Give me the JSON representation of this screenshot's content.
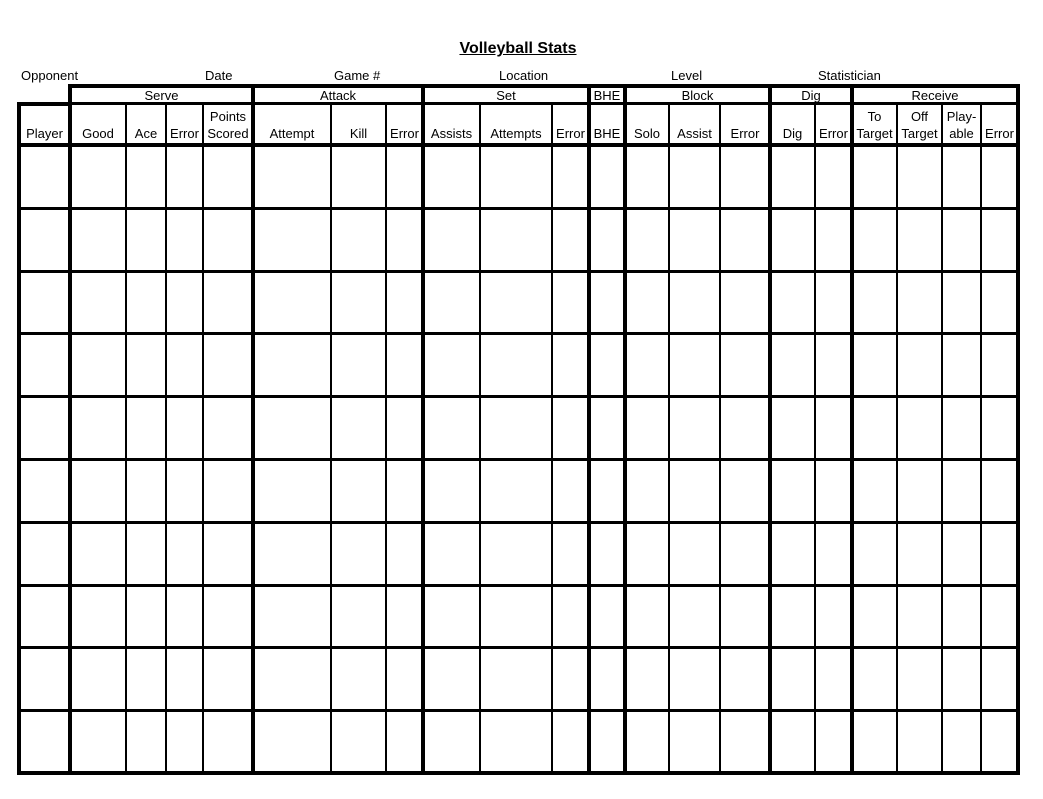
{
  "form": {
    "title": "Volleyball Stats",
    "meta_fields": [
      {
        "label": "Opponent"
      },
      {
        "label": "Date"
      },
      {
        "label": "Game #"
      },
      {
        "label": "Location"
      },
      {
        "label": "Level"
      },
      {
        "label": "Statistician"
      }
    ],
    "groups": [
      {
        "label": "Serve"
      },
      {
        "label": "Attack"
      },
      {
        "label": "Set"
      },
      {
        "label": "BHE"
      },
      {
        "label": "Block"
      },
      {
        "label": "Dig"
      },
      {
        "label": "Receive"
      }
    ],
    "columns": [
      {
        "line1": "",
        "line2": "Player"
      },
      {
        "line1": "",
        "line2": "Good"
      },
      {
        "line1": "",
        "line2": "Ace"
      },
      {
        "line1": "",
        "line2": "Error"
      },
      {
        "line1": "Points",
        "line2": "Scored"
      },
      {
        "line1": "",
        "line2": "Attempt"
      },
      {
        "line1": "",
        "line2": "Kill"
      },
      {
        "line1": "",
        "line2": "Error"
      },
      {
        "line1": "",
        "line2": "Assists"
      },
      {
        "line1": "",
        "line2": "Attempts"
      },
      {
        "line1": "",
        "line2": "Error"
      },
      {
        "line1": "",
        "line2": "BHE"
      },
      {
        "line1": "",
        "line2": "Solo"
      },
      {
        "line1": "",
        "line2": "Assist"
      },
      {
        "line1": "",
        "line2": "Error"
      },
      {
        "line1": "",
        "line2": "Dig"
      },
      {
        "line1": "",
        "line2": "Error"
      },
      {
        "line1": "To",
        "line2": "Target"
      },
      {
        "line1": "Off",
        "line2": "Target"
      },
      {
        "line1": "Play-",
        "line2": "able"
      },
      {
        "line1": "",
        "line2": "Error"
      }
    ],
    "row_count": 10
  }
}
